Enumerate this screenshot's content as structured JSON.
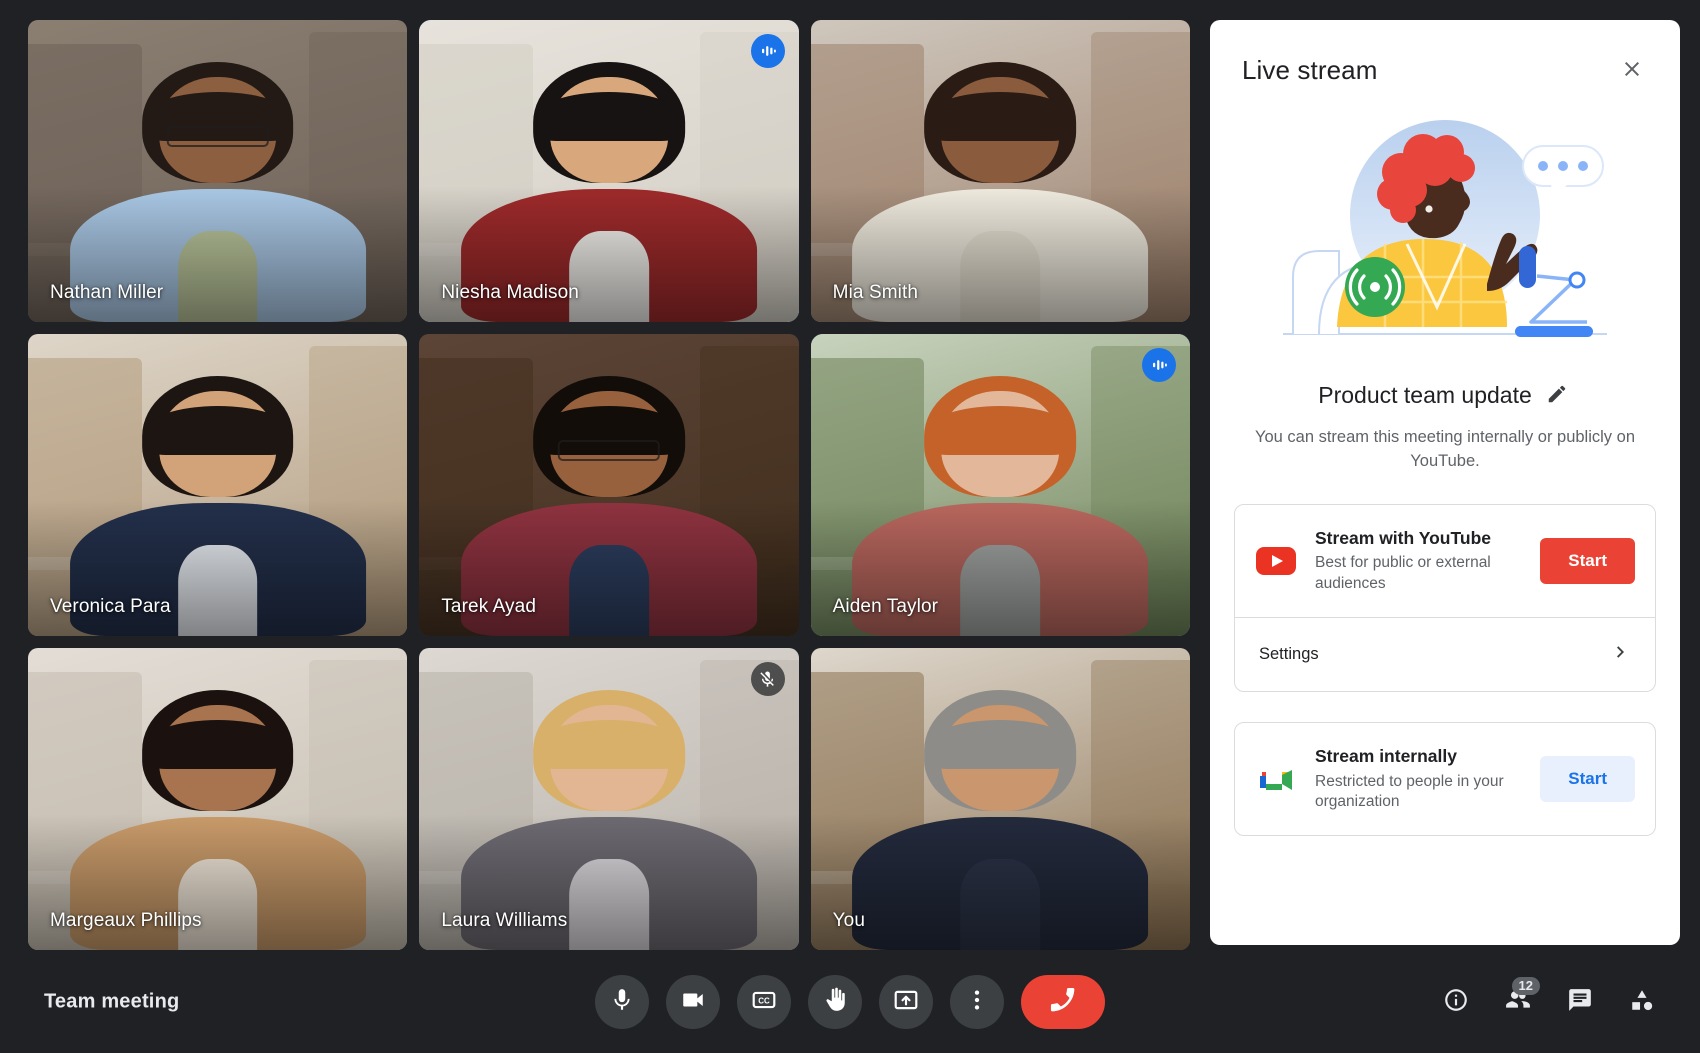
{
  "app": {
    "name": "Google Meet",
    "meeting_title": "Team meeting",
    "background_color": "#202124"
  },
  "grid": {
    "participants": [
      {
        "name": "Nathan Miller",
        "status": "none",
        "speaking": false,
        "muted": false,
        "scene": {
          "wall": "#8b7f72",
          "wall2": "#6d6158",
          "skin": "#8d5f41",
          "hair": "#241a15",
          "shirt": "#a9c7e4",
          "inner": "#b9c49a",
          "glasses": true
        }
      },
      {
        "name": "Niesha Madison",
        "status": "speaking",
        "speaking": true,
        "muted": false,
        "scene": {
          "wall": "#e7e3dc",
          "wall2": "#d2cdc3",
          "skin": "#d9a77c",
          "hair": "#161312",
          "shirt": "#9e2a2b",
          "inner": "#f2f0ec",
          "glasses": false
        }
      },
      {
        "name": "Mia Smith",
        "status": "none",
        "speaking": false,
        "muted": false,
        "scene": {
          "wall": "#cfc7bd",
          "wall2": "#9c7f6a",
          "skin": "#8a5c3d",
          "hair": "#2a1c15",
          "shirt": "#efeade",
          "inner": "#e6e0d2",
          "glasses": false
        }
      },
      {
        "name": "Veronica Para",
        "status": "none",
        "speaking": false,
        "muted": false,
        "scene": {
          "wall": "#ded6c9",
          "wall2": "#b29a7c",
          "skin": "#d2a278",
          "hair": "#1d1512",
          "shirt": "#23304b",
          "inner": "#e9edf2",
          "glasses": false
        }
      },
      {
        "name": "Tarek Ayad",
        "status": "none",
        "speaking": false,
        "muted": false,
        "scene": {
          "wall": "#5c4436",
          "wall2": "#43301f",
          "skin": "#96613c",
          "hair": "#130d0a",
          "shirt": "#8f3340",
          "inner": "#2c3d5e",
          "glasses": true
        }
      },
      {
        "name": "Aiden Taylor",
        "status": "speaking",
        "speaking": true,
        "muted": false,
        "scene": {
          "wall": "#c8d3bd",
          "wall2": "#6d8257",
          "skin": "#e2b79a",
          "hair": "#c4622a",
          "shirt": "#b9675e",
          "inner": "#9fa3a0",
          "glasses": false
        }
      },
      {
        "name": "Margeaux Phillips",
        "status": "none",
        "speaking": false,
        "muted": false,
        "scene": {
          "wall": "#e3ddd6",
          "wall2": "#c4bcae",
          "skin": "#a7744f",
          "hair": "#1b1210",
          "shirt": "#c99b6a",
          "inner": "#f0e6d8",
          "glasses": false
        }
      },
      {
        "name": "Laura Williams",
        "status": "muted",
        "speaking": false,
        "muted": true,
        "scene": {
          "wall": "#ddd8d2",
          "wall2": "#b6b0a8",
          "skin": "#e3b693",
          "hair": "#d8b06a",
          "shirt": "#6e6a72",
          "inner": "#dcd8dd",
          "glasses": false
        }
      },
      {
        "name": "You",
        "status": "none",
        "speaking": false,
        "muted": false,
        "scene": {
          "wall": "#ded7cc",
          "wall2": "#8c7252",
          "skin": "#c9966d",
          "hair": "#8e8c89",
          "shirt": "#232a3c",
          "inner": "#2b3246",
          "glasses": false
        }
      }
    ]
  },
  "panel": {
    "title": "Live stream",
    "close_icon": "close-icon",
    "illustration_name": "live-stream-illustration",
    "meeting_name": "Product team update",
    "edit_icon": "pencil-icon",
    "description": "You can stream this meeting internally or publicly on YouTube.",
    "cards": [
      {
        "icon": "youtube-icon",
        "title": "Stream with YouTube",
        "subtitle": "Best for public or external audiences",
        "button_label": "Start",
        "button_style": "red",
        "button_color": "#ea4335",
        "settings_label": "Settings",
        "settings_chevron": "chevron-right-icon"
      },
      {
        "icon": "google-meet-icon",
        "title": "Stream internally",
        "subtitle": "Restricted to people in your organization",
        "button_label": "Start",
        "button_style": "blue",
        "button_color": "#e8f0fe",
        "button_text_color": "#1a73e8"
      }
    ]
  },
  "bottom_bar": {
    "meeting_title": "Team meeting",
    "controls": [
      {
        "name": "microphone-button",
        "icon": "microphone-icon",
        "state": "on"
      },
      {
        "name": "camera-button",
        "icon": "camera-icon",
        "state": "on"
      },
      {
        "name": "captions-button",
        "icon": "closed-captions-icon",
        "state": "off"
      },
      {
        "name": "raise-hand-button",
        "icon": "raise-hand-icon",
        "state": "off"
      },
      {
        "name": "present-now-button",
        "icon": "present-screen-icon",
        "state": "off"
      },
      {
        "name": "more-options-button",
        "icon": "more-vertical-icon",
        "state": "off"
      },
      {
        "name": "end-call-button",
        "icon": "end-call-icon",
        "state": "end"
      }
    ],
    "right_controls": [
      {
        "name": "meeting-details-button",
        "icon": "info-icon",
        "badge": null
      },
      {
        "name": "people-button",
        "icon": "people-icon",
        "badge": "12"
      },
      {
        "name": "chat-button",
        "icon": "chat-icon",
        "badge": null
      },
      {
        "name": "activities-button",
        "icon": "activities-icon",
        "badge": null
      }
    ]
  },
  "colors": {
    "accent_blue": "#1a73e8",
    "speaking_border": "#8ab4f8",
    "red": "#ea4335",
    "panel_bg": "#ffffff",
    "app_bg": "#202124"
  }
}
